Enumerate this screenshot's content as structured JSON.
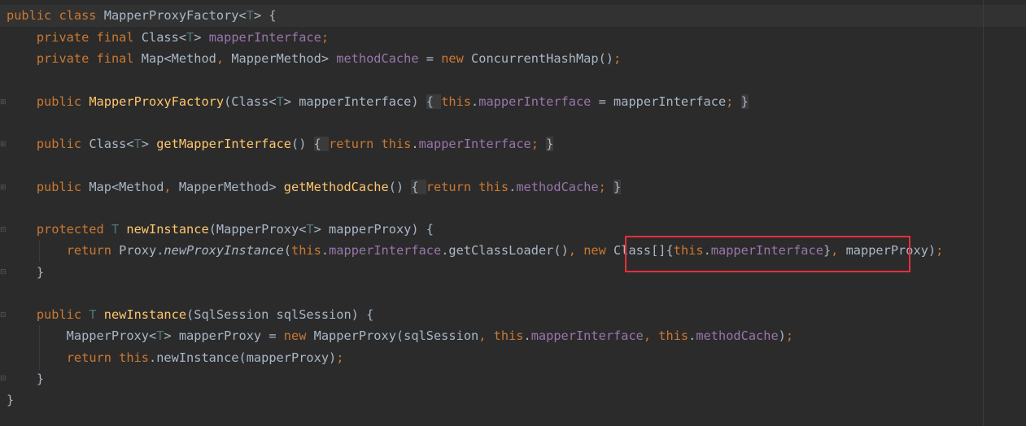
{
  "editor": {
    "colors": {
      "background": "#2b2b2b",
      "keyword": "#cc7832",
      "field": "#9876aa",
      "type_param": "#507874",
      "method_decl": "#ffc66d",
      "plain": "#a9b7c6",
      "highlight_box": "#e2303a"
    },
    "lines": [
      [
        [
          "kw",
          "public class "
        ],
        [
          "pl",
          "MapperProxyFactory<"
        ],
        [
          "tp",
          "T"
        ],
        [
          "pl",
          "> {"
        ]
      ],
      [
        [
          "pl",
          "    "
        ],
        [
          "kw",
          "private final "
        ],
        [
          "pl",
          "Class<"
        ],
        [
          "tp",
          "T"
        ],
        [
          "pl",
          "> "
        ],
        [
          "fld",
          "mapperInterface"
        ],
        [
          "kw",
          ";"
        ]
      ],
      [
        [
          "pl",
          "    "
        ],
        [
          "kw",
          "private final "
        ],
        [
          "pl",
          "Map<Method"
        ],
        [
          "kw",
          ", "
        ],
        [
          "pl",
          "MapperMethod> "
        ],
        [
          "fld",
          "methodCache "
        ],
        [
          "pl",
          "= "
        ],
        [
          "kw",
          "new "
        ],
        [
          "pl",
          "ConcurrentHashMap()"
        ],
        [
          "kw",
          ";"
        ]
      ],
      [
        [
          "pl",
          " "
        ]
      ],
      [
        [
          "pl",
          "    "
        ],
        [
          "kw",
          "public "
        ],
        [
          "fn",
          "MapperProxyFactory"
        ],
        [
          "pl",
          "(Class<"
        ],
        [
          "tp",
          "T"
        ],
        [
          "pl",
          "> mapperInterface) "
        ],
        [
          "fb",
          "{ "
        ],
        [
          "kw",
          "this"
        ],
        [
          "pl",
          "."
        ],
        [
          "fld",
          "mapperInterface "
        ],
        [
          "pl",
          "= mapperInterface"
        ],
        [
          "kw",
          "; "
        ],
        [
          "fb",
          "}"
        ]
      ],
      [
        [
          "pl",
          " "
        ]
      ],
      [
        [
          "pl",
          "    "
        ],
        [
          "kw",
          "public "
        ],
        [
          "pl",
          "Class<"
        ],
        [
          "tp",
          "T"
        ],
        [
          "pl",
          "> "
        ],
        [
          "fn",
          "getMapperInterface"
        ],
        [
          "pl",
          "() "
        ],
        [
          "fb",
          "{ "
        ],
        [
          "kw",
          "return this"
        ],
        [
          "pl",
          "."
        ],
        [
          "fld",
          "mapperInterface"
        ],
        [
          "kw",
          "; "
        ],
        [
          "fb",
          "}"
        ]
      ],
      [
        [
          "pl",
          " "
        ]
      ],
      [
        [
          "pl",
          "    "
        ],
        [
          "kw",
          "public "
        ],
        [
          "pl",
          "Map<Method"
        ],
        [
          "kw",
          ", "
        ],
        [
          "pl",
          "MapperMethod> "
        ],
        [
          "fn",
          "getMethodCache"
        ],
        [
          "pl",
          "() "
        ],
        [
          "fb",
          "{ "
        ],
        [
          "kw",
          "return this"
        ],
        [
          "pl",
          "."
        ],
        [
          "fld",
          "methodCache"
        ],
        [
          "kw",
          "; "
        ],
        [
          "fb",
          "}"
        ]
      ],
      [
        [
          "pl",
          " "
        ]
      ],
      [
        [
          "pl",
          "    "
        ],
        [
          "kw",
          "protected "
        ],
        [
          "tp",
          "T "
        ],
        [
          "fn",
          "newInstance"
        ],
        [
          "pl",
          "(MapperProxy<"
        ],
        [
          "tp",
          "T"
        ],
        [
          "pl",
          "> mapperProxy) {"
        ]
      ],
      [
        [
          "pl",
          "        "
        ],
        [
          "kw",
          "return "
        ],
        [
          "pl",
          "Proxy."
        ],
        [
          "pl it",
          "newProxyInstance"
        ],
        [
          "pl",
          "("
        ],
        [
          "kw",
          "this"
        ],
        [
          "pl",
          "."
        ],
        [
          "fld",
          "mapperInterface"
        ],
        [
          "pl",
          ".getClassLoader()"
        ],
        [
          "kw",
          ", new "
        ],
        [
          "pl",
          "Class[]{"
        ],
        [
          "kw",
          "this"
        ],
        [
          "pl",
          "."
        ],
        [
          "fld",
          "mapperInterface"
        ],
        [
          "pl",
          "}"
        ],
        [
          "kw",
          ", "
        ],
        [
          "pl",
          "mapperProxy)"
        ],
        [
          "kw",
          ";"
        ]
      ],
      [
        [
          "pl",
          "    }"
        ]
      ],
      [
        [
          "pl",
          " "
        ]
      ],
      [
        [
          "pl",
          "    "
        ],
        [
          "kw",
          "public "
        ],
        [
          "tp",
          "T "
        ],
        [
          "fn",
          "newInstance"
        ],
        [
          "pl",
          "(SqlSession sqlSession) {"
        ]
      ],
      [
        [
          "pl",
          "        MapperProxy<"
        ],
        [
          "tp",
          "T"
        ],
        [
          "pl",
          "> mapperProxy = "
        ],
        [
          "kw",
          "new "
        ],
        [
          "pl",
          "MapperProxy(sqlSession"
        ],
        [
          "kw",
          ", this"
        ],
        [
          "pl",
          "."
        ],
        [
          "fld",
          "mapperInterface"
        ],
        [
          "kw",
          ", this"
        ],
        [
          "pl",
          "."
        ],
        [
          "fld",
          "methodCache"
        ],
        [
          "pl",
          ")"
        ],
        [
          "kw",
          ";"
        ]
      ],
      [
        [
          "pl",
          "        "
        ],
        [
          "kw",
          "return this"
        ],
        [
          "pl",
          ".newInstance(mapperProxy)"
        ],
        [
          "kw",
          ";"
        ]
      ],
      [
        [
          "pl",
          "    }"
        ]
      ],
      [
        [
          "pl",
          "}"
        ]
      ]
    ]
  }
}
